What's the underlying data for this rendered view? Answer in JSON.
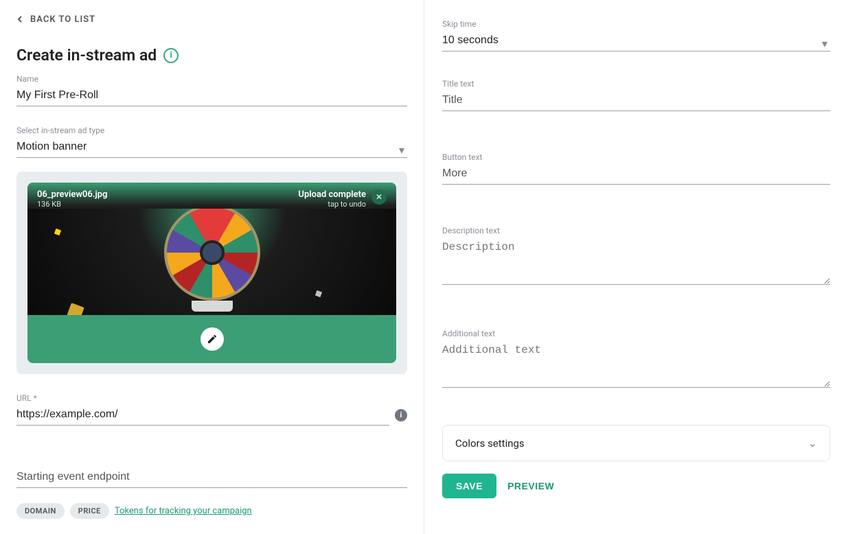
{
  "back_label": "BACK TO LIST",
  "page_title": "Create in-stream ad",
  "fields": {
    "name_label": "Name",
    "name_value": "My First Pre-Roll",
    "type_label": "Select in-stream ad type",
    "type_value": "Motion banner",
    "url_label": "URL *",
    "url_value": "https://example.com/",
    "start_event_label": "Starting event endpoint",
    "start_event_value": "",
    "skip_label": "Skip time",
    "skip_value": "10 seconds",
    "title_text_label": "Title text",
    "title_text_placeholder": "Title",
    "button_text_label": "Button text",
    "button_text_placeholder": "More",
    "description_label": "Description text",
    "description_placeholder": "Description",
    "additional_label": "Additional text",
    "additional_placeholder": "Additional text"
  },
  "upload": {
    "file_name": "06_preview06.jpg",
    "file_size": "136 KB",
    "status": "Upload complete",
    "undo_hint": "tap to undo"
  },
  "chips": {
    "domain": "DOMAIN",
    "price": "PRICE"
  },
  "tokens_link": "Tokens for tracking your campaign",
  "accordion": {
    "colors": "Colors settings"
  },
  "buttons": {
    "save": "SAVE",
    "preview": "PREVIEW"
  }
}
